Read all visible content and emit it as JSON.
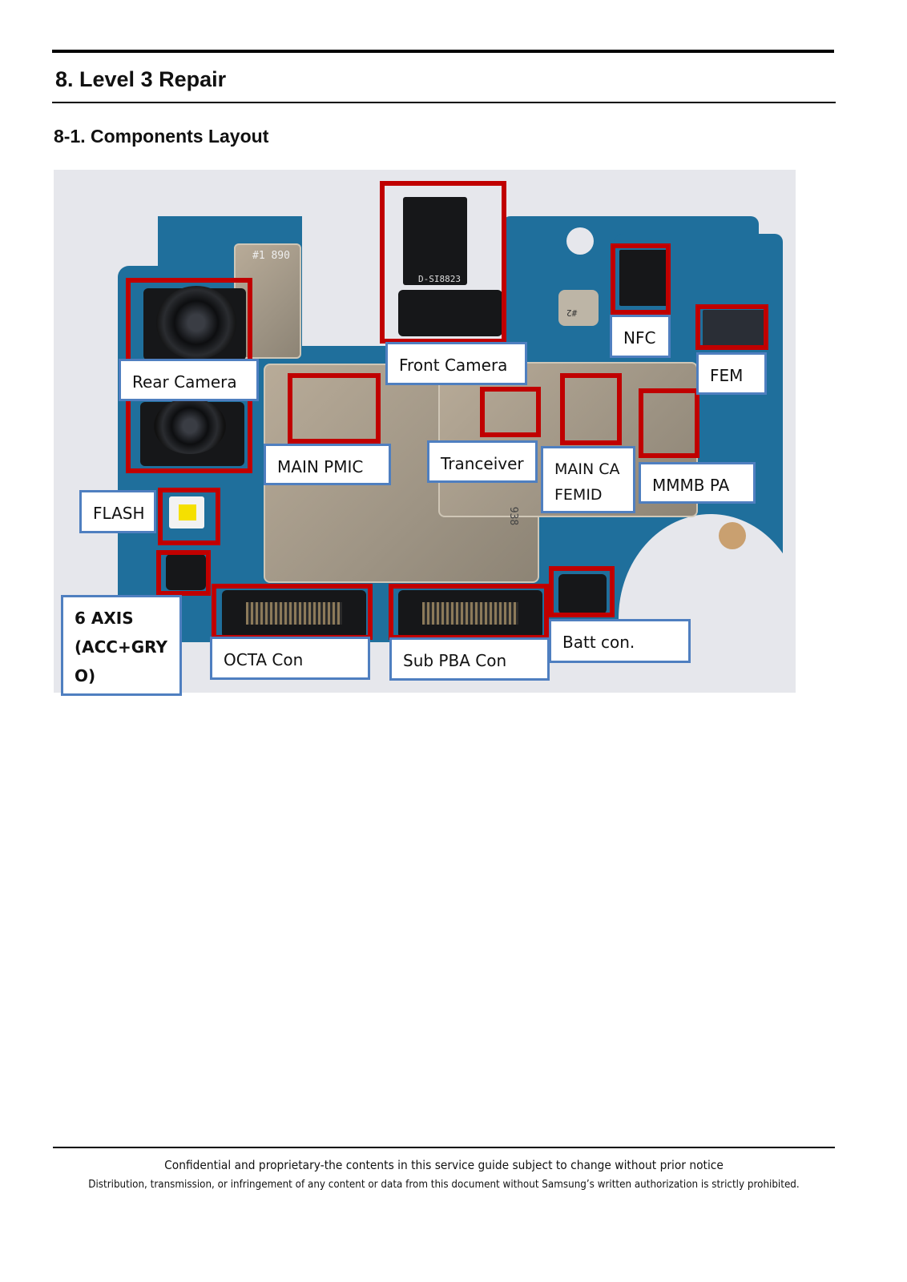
{
  "header": {
    "section_title": "8. Level 3 Repair",
    "subsection_title": "8-1. Components Layout"
  },
  "layout_image": {
    "photo_markings": [
      "#1 890",
      "D-SI8823",
      "#2",
      "938"
    ],
    "highlight_color": "#c00000",
    "label_border_color": "#4f7fc0",
    "labels": {
      "rear_camera": "Rear Camera",
      "front_camera": "Front Camera",
      "nfc": "NFC",
      "fem": "FEM",
      "main_pmic": "MAIN PMIC",
      "tranceiver": "Tranceiver",
      "main_ca_femid_1": "MAIN CA",
      "main_ca_femid_2": "FEMID",
      "mmmb_pa": "MMMB PA",
      "flash": "FLASH",
      "six_axis_1": "6 AXIS",
      "six_axis_2": "(ACC+GRY",
      "six_axis_3": "O)",
      "octa_con": "OCTA Con",
      "sub_pba_con": "Sub PBA Con",
      "batt_con": "Batt con."
    }
  },
  "footer": {
    "line1": "Confidential and proprietary-the contents in this service guide subject to change without prior notice",
    "line2": "Distribution, transmission, or infringement of any content or data from this document without Samsung’s written authorization is strictly prohibited."
  }
}
